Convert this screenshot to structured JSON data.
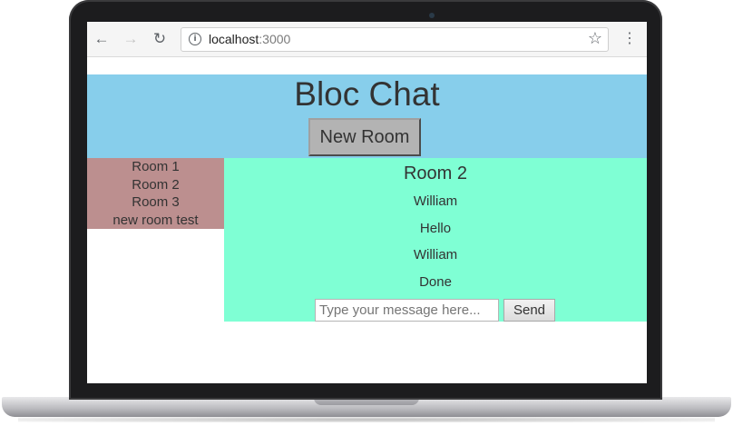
{
  "browser": {
    "back_icon": "arrow-left-icon",
    "forward_icon": "arrow-right-icon",
    "reload_icon": "reload-icon",
    "url_host": "localhost",
    "url_port": ":3000",
    "bookmark_icon": "star-icon",
    "menu_icon": "kebab-menu-icon"
  },
  "app": {
    "title": "Bloc Chat",
    "new_room_label": "New Room",
    "header_color": "#87ceeb"
  },
  "sidebar": {
    "color": "#bc8f8f",
    "rooms": [
      {
        "label": "Room 1"
      },
      {
        "label": "Room 2"
      },
      {
        "label": "Room 3"
      },
      {
        "label": "new room test"
      }
    ]
  },
  "chat": {
    "color": "#7fffd4",
    "room_title": "Room 2",
    "messages": [
      {
        "text": "William"
      },
      {
        "text": "Hello"
      },
      {
        "text": "William"
      },
      {
        "text": "Done"
      }
    ],
    "input_placeholder": "Type your message here...",
    "input_value": "",
    "send_label": "Send"
  }
}
